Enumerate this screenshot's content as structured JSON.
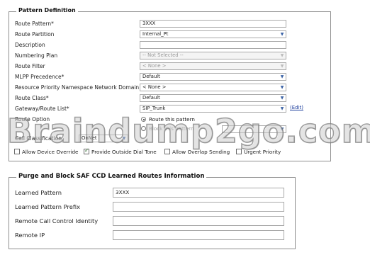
{
  "pattern_definition": {
    "legend": "Pattern Definition",
    "fields": [
      {
        "label": "Route Pattern*",
        "value": "3XXX",
        "type": "text"
      },
      {
        "label": "Route Partition",
        "value": "Internal_Pt",
        "type": "select"
      },
      {
        "label": "Description",
        "value": "",
        "type": "text"
      },
      {
        "label": "Numbering Plan",
        "value": "-- Not Selected --",
        "type": "select",
        "disabled": true
      },
      {
        "label": "Route Filter",
        "value": "< None >",
        "type": "select",
        "disabled": true
      },
      {
        "label": "MLPP Precedence*",
        "value": "Default",
        "type": "select"
      },
      {
        "label": "Resource Priority Namespace Network Domain",
        "value": "< None >",
        "type": "select"
      },
      {
        "label": "Route Class*",
        "value": "Default",
        "type": "select"
      },
      {
        "label": "Gateway/Route List*",
        "value": "SIP_Trunk",
        "type": "select"
      }
    ],
    "edit_link": "(Edit)",
    "route_option": {
      "label": "Route Option",
      "options": [
        "Route this pattern",
        "Block this pattern"
      ]
    },
    "call_classification": {
      "label": "Call Classification",
      "value": "OnNet"
    },
    "checkboxes": [
      {
        "label": "Allow Device Override",
        "checked": false
      },
      {
        "label": "Provide Outside Dial Tone",
        "checked": true
      },
      {
        "label": "Allow Overlap Sending",
        "checked": false
      },
      {
        "label": "Urgent Priority",
        "checked": false
      }
    ]
  },
  "watermark": "Braindump2go.com",
  "saf_section": {
    "legend": "Purge and Block SAF CCD Learned Routes Information",
    "fields": [
      {
        "label": "Learned Pattern",
        "value": "3XXX"
      },
      {
        "label": "Learned Pattern Prefix",
        "value": ""
      },
      {
        "label": "Remote Call Control Identity",
        "value": ""
      },
      {
        "label": "Remote IP",
        "value": ""
      }
    ]
  }
}
